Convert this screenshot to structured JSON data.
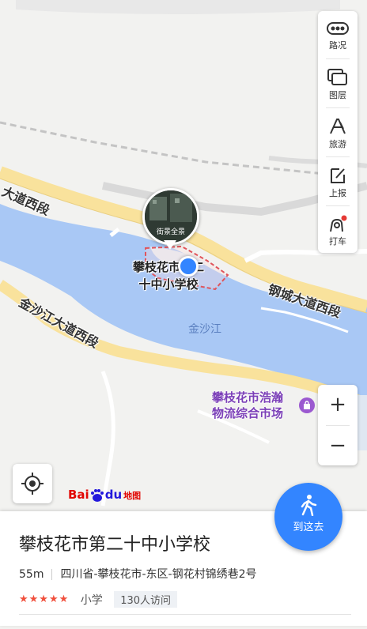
{
  "map": {
    "road_labels": [
      "大道西段",
      "钢城大道西段",
      "金沙江大道西段"
    ],
    "river_label": "金沙江",
    "school_label_lines": [
      "攀枝花市第二",
      "十中小学校"
    ],
    "pin_caption": "街景全景",
    "market_label_lines": [
      "攀枝花市浩瀚",
      "物流综合市场"
    ]
  },
  "toolbar": {
    "items": [
      {
        "label": "路况",
        "icon": "traffic-icon"
      },
      {
        "label": "图层",
        "icon": "layers-icon"
      },
      {
        "label": "旅游",
        "icon": "travel-icon"
      },
      {
        "label": "上报",
        "icon": "report-icon"
      },
      {
        "label": "打车",
        "icon": "taxi-icon"
      }
    ]
  },
  "zoom": {
    "in_label": "+",
    "out_label": "−"
  },
  "logo": {
    "bai": "Bai",
    "du": "du",
    "map_word": "地图"
  },
  "navigate": {
    "label": "到这去"
  },
  "place": {
    "name": "攀枝花市第二十中小学校",
    "distance": "55m",
    "address": "四川省-攀枝花市-东区-钢花村锦绣巷2号",
    "rating_stars": "★★★★★",
    "category": "小学",
    "visits": "130人访问"
  },
  "colors": {
    "accent": "#3385ff",
    "river": "#a9c8f5",
    "road": "#f9e29c",
    "star": "#f04f3c",
    "poi_purple": "#7b3fb8"
  }
}
